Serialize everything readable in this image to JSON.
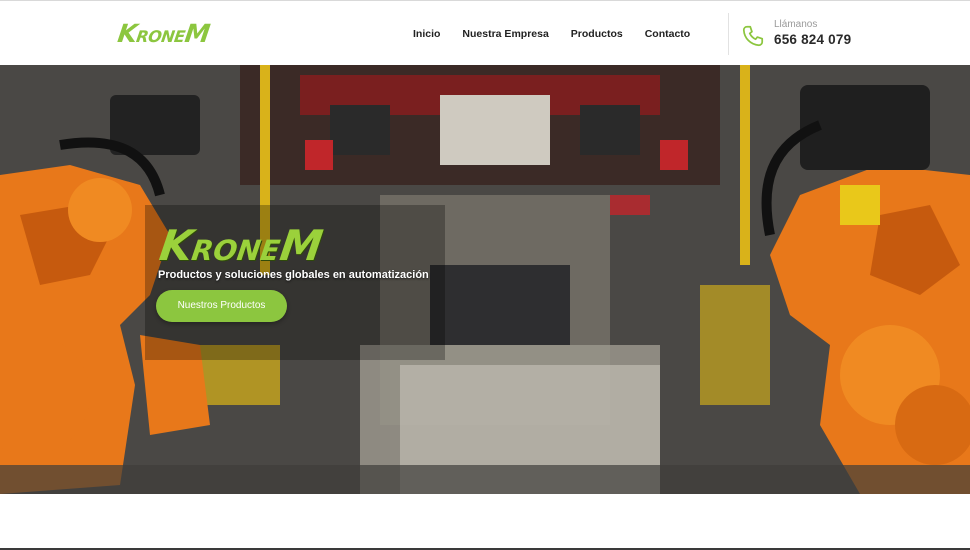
{
  "header": {
    "logo_text": "KroneM",
    "nav": [
      "Inicio",
      "Nuestra Empresa",
      "Productos",
      "Contacto"
    ],
    "call_label": "Llámanos",
    "phone": "656 824 079"
  },
  "hero": {
    "logo_text": "KroneM",
    "subtitle": "Productos y soluciones globales en automatización",
    "button_label": "Nuestros Productos"
  },
  "icons": {
    "phone": "phone-icon"
  },
  "colors": {
    "brand_green": "#8cc63f",
    "robot_orange": "#e8781a",
    "text_dark": "#222222"
  }
}
